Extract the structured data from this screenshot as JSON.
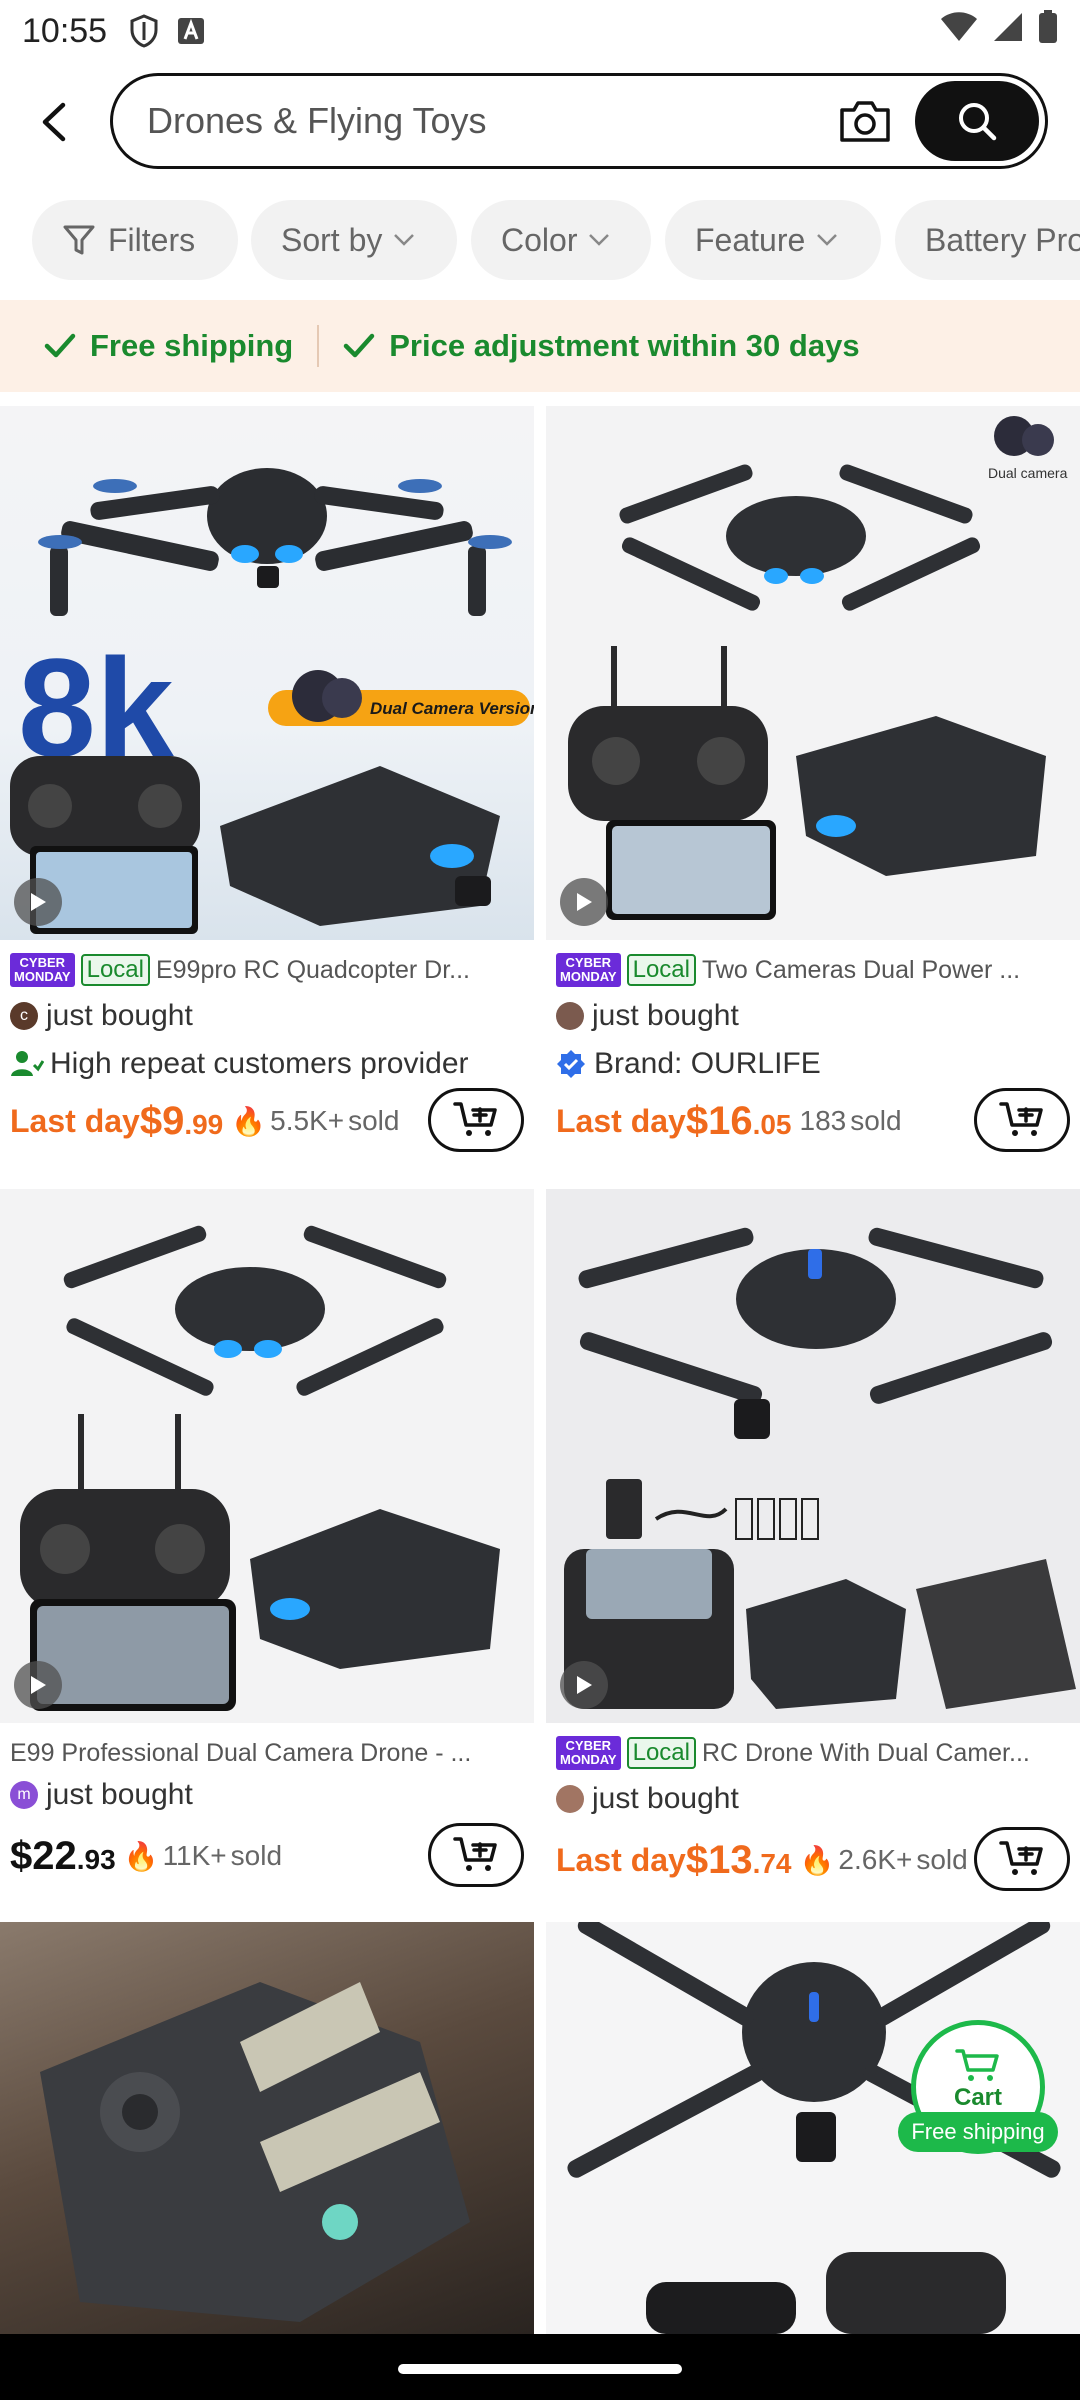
{
  "status_bar": {
    "time": "10:55",
    "icons": [
      "shield-icon",
      "font-icon",
      "wifi-icon",
      "signal-icon",
      "battery-icon"
    ]
  },
  "search": {
    "query": "Drones & Flying Toys",
    "icons": {
      "back": "chevron-left-icon",
      "camera": "camera-icon",
      "search": "search-icon"
    }
  },
  "filters": [
    {
      "label": "Filters",
      "icon": "filter-icon"
    },
    {
      "label": "Sort by",
      "icon": "chevron-down-icon"
    },
    {
      "label": "Color",
      "icon": "chevron-down-icon"
    },
    {
      "label": "Feature",
      "icon": "chevron-down-icon"
    },
    {
      "label": "Battery Pro",
      "icon": ""
    }
  ],
  "benefits": [
    {
      "label": "Free shipping"
    },
    {
      "label": "Price adjustment within 30 days"
    }
  ],
  "badges": {
    "cyber_line1": "CYBER",
    "cyber_line2": "MONDAY",
    "local": "Local"
  },
  "products": [
    {
      "title": "E99pro RC Quadcopter Dr...",
      "image_overlay": {
        "big_text": "8k",
        "banner": "Dual Camera Version"
      },
      "bought": "just bought",
      "avatar_letter": "c",
      "extra": "High repeat customers provider",
      "price_label": "Last day",
      "price_main": "$9",
      "price_cents": ".99",
      "sold": "5.5K+",
      "sold_suffix": "sold"
    },
    {
      "title": "Two Cameras Dual Power ...",
      "image_overlay": {
        "corner_label": "Dual camera"
      },
      "bought": "just bought",
      "extra": "Brand: OURLIFE",
      "price_label": "Last day",
      "price_main": "$16",
      "price_cents": ".05",
      "sold": "183",
      "sold_suffix": "sold"
    },
    {
      "title": "E99 Professional Dual Camera Drone - ...",
      "bought": "just bought",
      "avatar_letter": "m",
      "price_main": "$22",
      "price_cents": ".93",
      "sold": "11K+",
      "sold_suffix": "sold"
    },
    {
      "title": "RC Drone With Dual Camer...",
      "bought": "just bought",
      "price_label": "Last day",
      "price_main": "$13",
      "price_cents": ".74",
      "sold": "2.6K+",
      "sold_suffix": "sold"
    }
  ],
  "floating_cart": {
    "label": "Cart",
    "shipping": "Free shipping"
  },
  "colors": {
    "accent_orange": "#f06a1c",
    "green": "#1a8a2e",
    "purple_badge": "#6b2bd9",
    "banner_bg": "#fdf0e6"
  }
}
